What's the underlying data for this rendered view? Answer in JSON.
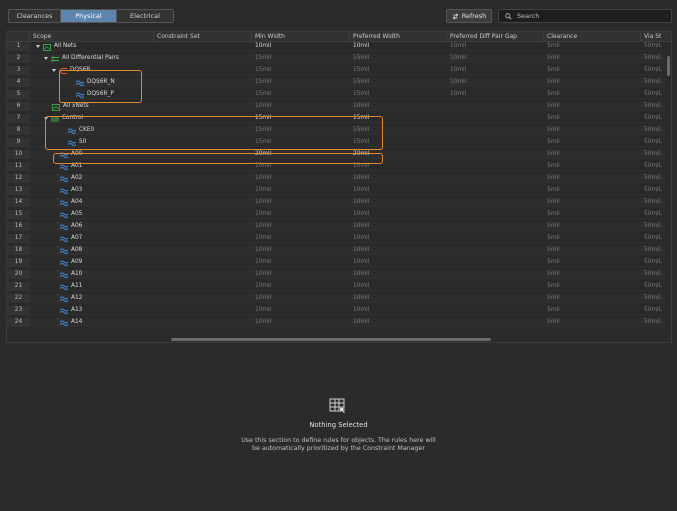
{
  "tabs": [
    {
      "label": "Clearances",
      "active": false
    },
    {
      "label": "Physical",
      "active": true
    },
    {
      "label": "Electrical",
      "active": false
    }
  ],
  "toolbar": {
    "refresh_label": "Refresh",
    "search_placeholder": "Search"
  },
  "table": {
    "columns": [
      "",
      "Scope",
      "Constraint Set",
      "Min Width",
      "Preferred Width",
      "Preferred Diff Pair Gap",
      "Clearance",
      "Via St"
    ],
    "rows": [
      {
        "n": "1",
        "scope": "All Nets",
        "indent": 0,
        "icon": "net-group-icon",
        "expand": true,
        "cs": "",
        "min": "10mil",
        "pref": "10mil",
        "gap": "10mil",
        "clr": "5mil",
        "via": "50mil,",
        "bright": true
      },
      {
        "n": "2",
        "scope": "All Differential Pairs",
        "indent": 1,
        "icon": "diff-group-icon",
        "expand": true,
        "cs": "",
        "min": "15mil",
        "pref": "15mil",
        "gap": "10mil",
        "clr": "5mil",
        "via": "50mil,",
        "bright": false
      },
      {
        "n": "3",
        "scope": "DQS6R",
        "indent": 2,
        "icon": "diff-pair-icon",
        "expand": true,
        "cs": "",
        "min": "15mil",
        "pref": "15mil",
        "gap": "10mil",
        "clr": "5mil",
        "via": "50mil,",
        "bright": false
      },
      {
        "n": "4",
        "scope": "DQS6R_N",
        "indent": 4,
        "icon": "net-icon",
        "expand": false,
        "cs": "",
        "min": "15mil",
        "pref": "15mil",
        "gap": "10mil",
        "clr": "5mil",
        "via": "50mil,",
        "bright": false
      },
      {
        "n": "5",
        "scope": "DQS6R_P",
        "indent": 4,
        "icon": "net-icon",
        "expand": false,
        "cs": "",
        "min": "15mil",
        "pref": "15mil",
        "gap": "10mil",
        "clr": "5mil",
        "via": "50mil,",
        "bright": false
      },
      {
        "n": "6",
        "scope": "All xNets",
        "indent": 1,
        "icon": "xnet-group-icon",
        "expand": false,
        "cs": "",
        "min": "10mil",
        "pref": "10mil",
        "gap": "",
        "clr": "5mil",
        "via": "50mil,",
        "bright": false
      },
      {
        "n": "7",
        "scope": "Control",
        "indent": 1,
        "icon": "net-class-icon",
        "expand": true,
        "cs": "",
        "min": "15mil",
        "pref": "15mil",
        "gap": "",
        "clr": "5mil",
        "via": "50mil,",
        "bright": true
      },
      {
        "n": "8",
        "scope": "CKE0",
        "indent": 3,
        "icon": "net-icon",
        "expand": false,
        "cs": "",
        "min": "15mil",
        "pref": "15mil",
        "gap": "",
        "clr": "5mil",
        "via": "50mil,",
        "bright": false
      },
      {
        "n": "9",
        "scope": "S0",
        "indent": 3,
        "icon": "net-icon",
        "expand": false,
        "cs": "",
        "min": "15mil",
        "pref": "15mil",
        "gap": "",
        "clr": "5mil",
        "via": "50mil,",
        "bright": false
      },
      {
        "n": "10",
        "scope": "A00",
        "indent": 2,
        "icon": "net-icon",
        "expand": false,
        "cs": "",
        "min": "20mil",
        "pref": "20mil",
        "gap": "",
        "clr": "5mil",
        "via": "50mil,",
        "bright": true
      },
      {
        "n": "11",
        "scope": "A01",
        "indent": 2,
        "icon": "net-icon",
        "expand": false,
        "cs": "",
        "min": "10mil",
        "pref": "10mil",
        "gap": "",
        "clr": "5mil",
        "via": "50mil,",
        "bright": false
      },
      {
        "n": "12",
        "scope": "A02",
        "indent": 2,
        "icon": "net-icon",
        "expand": false,
        "cs": "",
        "min": "10mil",
        "pref": "10mil",
        "gap": "",
        "clr": "5mil",
        "via": "50mil,",
        "bright": false
      },
      {
        "n": "13",
        "scope": "A03",
        "indent": 2,
        "icon": "net-icon",
        "expand": false,
        "cs": "",
        "min": "10mil",
        "pref": "10mil",
        "gap": "",
        "clr": "5mil",
        "via": "50mil,",
        "bright": false
      },
      {
        "n": "14",
        "scope": "A04",
        "indent": 2,
        "icon": "net-icon",
        "expand": false,
        "cs": "",
        "min": "10mil",
        "pref": "10mil",
        "gap": "",
        "clr": "5mil",
        "via": "50mil,",
        "bright": false
      },
      {
        "n": "15",
        "scope": "A05",
        "indent": 2,
        "icon": "net-icon",
        "expand": false,
        "cs": "",
        "min": "10mil",
        "pref": "10mil",
        "gap": "",
        "clr": "5mil",
        "via": "50mil,",
        "bright": false
      },
      {
        "n": "16",
        "scope": "A06",
        "indent": 2,
        "icon": "net-icon",
        "expand": false,
        "cs": "",
        "min": "10mil",
        "pref": "10mil",
        "gap": "",
        "clr": "5mil",
        "via": "50mil,",
        "bright": false
      },
      {
        "n": "17",
        "scope": "A07",
        "indent": 2,
        "icon": "net-icon",
        "expand": false,
        "cs": "",
        "min": "10mil",
        "pref": "10mil",
        "gap": "",
        "clr": "5mil",
        "via": "50mil,",
        "bright": false
      },
      {
        "n": "18",
        "scope": "A08",
        "indent": 2,
        "icon": "net-icon",
        "expand": false,
        "cs": "",
        "min": "10mil",
        "pref": "10mil",
        "gap": "",
        "clr": "5mil",
        "via": "50mil,",
        "bright": false
      },
      {
        "n": "19",
        "scope": "A09",
        "indent": 2,
        "icon": "net-icon",
        "expand": false,
        "cs": "",
        "min": "10mil",
        "pref": "10mil",
        "gap": "",
        "clr": "5mil",
        "via": "50mil,",
        "bright": false
      },
      {
        "n": "20",
        "scope": "A10",
        "indent": 2,
        "icon": "net-icon",
        "expand": false,
        "cs": "",
        "min": "10mil",
        "pref": "10mil",
        "gap": "",
        "clr": "5mil",
        "via": "50mil,",
        "bright": false
      },
      {
        "n": "21",
        "scope": "A11",
        "indent": 2,
        "icon": "net-icon",
        "expand": false,
        "cs": "",
        "min": "10mil",
        "pref": "10mil",
        "gap": "",
        "clr": "5mil",
        "via": "50mil,",
        "bright": false
      },
      {
        "n": "22",
        "scope": "A12",
        "indent": 2,
        "icon": "net-icon",
        "expand": false,
        "cs": "",
        "min": "10mil",
        "pref": "10mil",
        "gap": "",
        "clr": "5mil",
        "via": "50mil,",
        "bright": false
      },
      {
        "n": "23",
        "scope": "A13",
        "indent": 2,
        "icon": "net-icon",
        "expand": false,
        "cs": "",
        "min": "10mil",
        "pref": "10mil",
        "gap": "",
        "clr": "5mil",
        "via": "50mil,",
        "bright": false
      },
      {
        "n": "24",
        "scope": "A14",
        "indent": 2,
        "icon": "net-icon",
        "expand": false,
        "cs": "",
        "min": "10mil",
        "pref": "10mil",
        "gap": "",
        "clr": "5mil",
        "via": "50mil,",
        "bright": false
      }
    ]
  },
  "empty_state": {
    "icon": "table-cursor-icon",
    "title": "Nothing Selected",
    "description_line1": "Use this section to define rules for objects. The rules here will",
    "description_line2": "be automatically prioritized by the Constraint Manager"
  },
  "colors": {
    "accent": "#5c86b0",
    "highlight": "#e0892f",
    "net_icon": "#4a8fe0",
    "group_icon": "#3fae49",
    "diff_pair_icon": "#e05a3a"
  }
}
